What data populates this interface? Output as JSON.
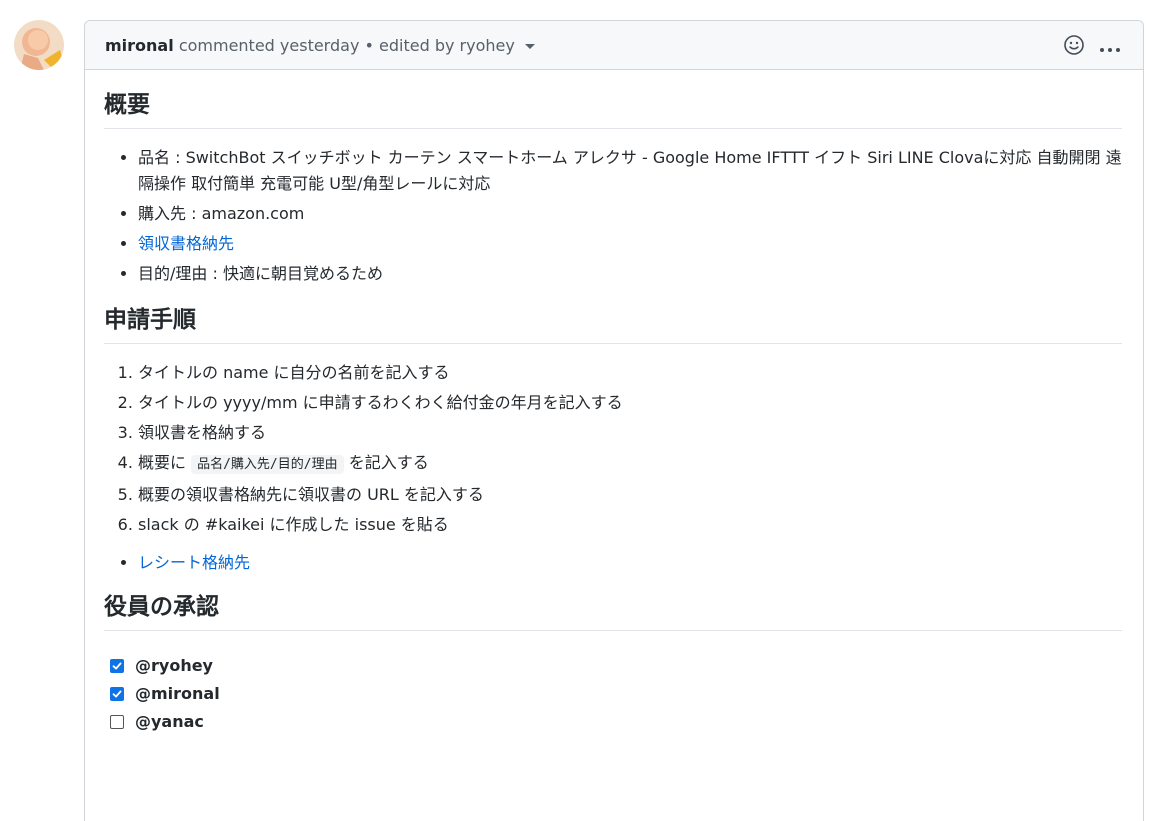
{
  "comment": {
    "author": "mironal",
    "meta": "commented yesterday • edited by ryohey"
  },
  "sections": {
    "overview": {
      "heading": "概要",
      "items": {
        "product": "品名 : SwitchBot スイッチボット カーテン スマートホーム アレクサ - Google Home IFTTT イフト Siri LINE Clovaに対応 自動開閉 遠隔操作 取付簡単 充電可能 U型/角型レールに対応",
        "store": "購入先 : amazon.com",
        "receipt_link": "領収書格納先",
        "purpose": "目的/理由 : 快適に朝目覚めるため"
      }
    },
    "procedure": {
      "heading": "申請手順",
      "steps": [
        "タイトルの name に自分の名前を記入する",
        "タイトルの yyyy/mm に申請するわくわく給付金の年月を記入する",
        "領収書を格納する",
        "概要に",
        "概要の領収書格納先に領収書の URL を記入する",
        "slack の #kaikei に作成した issue を貼る"
      ],
      "step4_code": "品名/購入先/目的/理由",
      "step4_suffix": "を記入する",
      "receipt_folder_link": "レシート格納先"
    },
    "approval": {
      "heading": "役員の承認",
      "approvers": [
        {
          "name": "@ryohey",
          "checked": true
        },
        {
          "name": "@mironal",
          "checked": true
        },
        {
          "name": "@yanac",
          "checked": false
        }
      ]
    }
  },
  "icons": {
    "reaction": "smiley-icon",
    "more": "kebab-horizontal-icon",
    "edited_caret": "triangle-down-icon"
  },
  "colors": {
    "link": "#0366d6",
    "checkbox": "#0f73e8",
    "header_bg": "#f6f8fa",
    "border": "#d1d5da"
  }
}
